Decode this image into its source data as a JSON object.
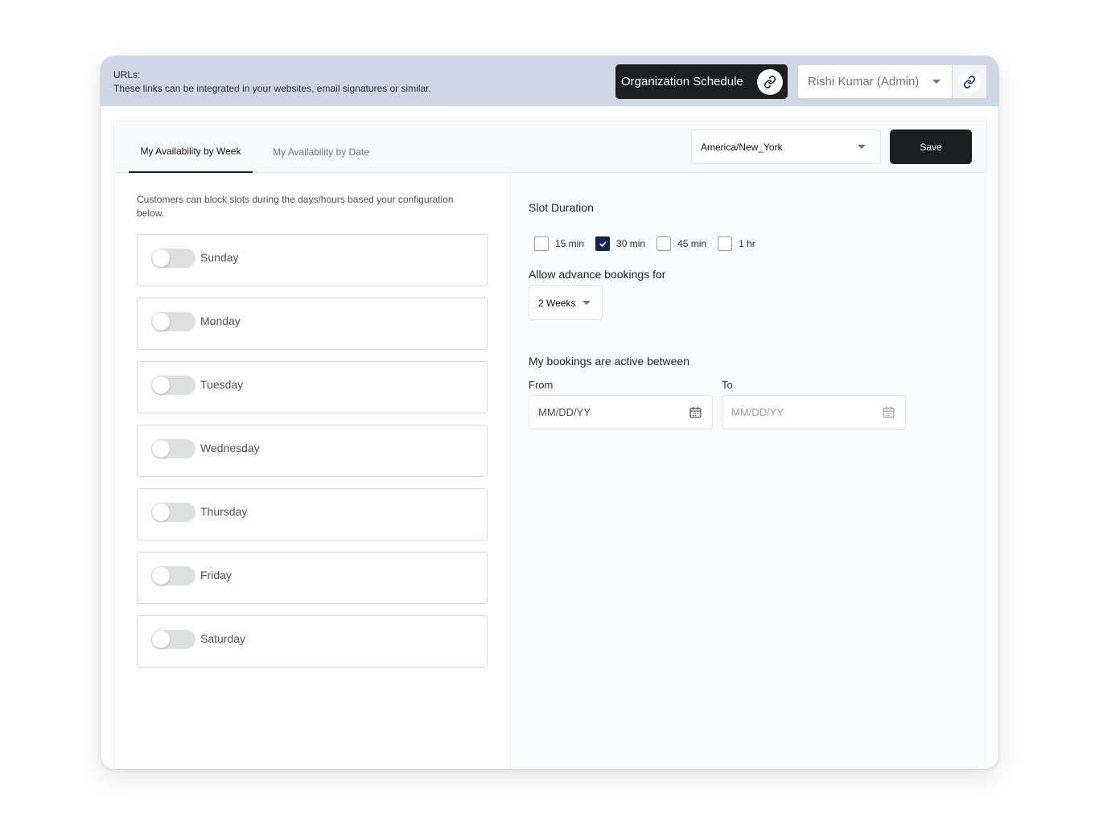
{
  "urls": {
    "title": "URLs:",
    "description": "These links can be integrated in your websites, email signatures or similar.",
    "org_schedule_label": "Organization Schedule",
    "user_select_value": "Rishi Kumar (Admin)"
  },
  "tabs": [
    {
      "label": "My Availability by Week",
      "active": true
    },
    {
      "label": "My Availability by Date",
      "active": false
    }
  ],
  "timezone": {
    "value": "America/New_York"
  },
  "save_label": "Save",
  "availability": {
    "description": "Customers can block slots during the days/hours based your configuration below.",
    "days": [
      {
        "label": "Sunday",
        "enabled": false
      },
      {
        "label": "Monday",
        "enabled": false
      },
      {
        "label": "Tuesday",
        "enabled": false
      },
      {
        "label": "Wednesday",
        "enabled": false
      },
      {
        "label": "Thursday",
        "enabled": false
      },
      {
        "label": "Friday",
        "enabled": false
      },
      {
        "label": "Saturday",
        "enabled": false
      }
    ]
  },
  "slot_duration": {
    "title": "Slot Duration",
    "options": [
      {
        "label": "15 min",
        "checked": false
      },
      {
        "label": "30 min",
        "checked": true
      },
      {
        "label": "45 min",
        "checked": false
      },
      {
        "label": "1 hr",
        "checked": false
      }
    ]
  },
  "advance_booking": {
    "title": "Allow advance bookings for",
    "value": "2 Weeks"
  },
  "active_between": {
    "title": "My bookings are active between",
    "from_label": "From",
    "to_label": "To",
    "from_placeholder": "MM/DD/YY",
    "to_placeholder": "MM/DD/YY"
  },
  "colors": {
    "url_bar": "#cfd6e6",
    "primary_dark": "#1c1f22",
    "checkbox_checked": "#0f2650"
  }
}
